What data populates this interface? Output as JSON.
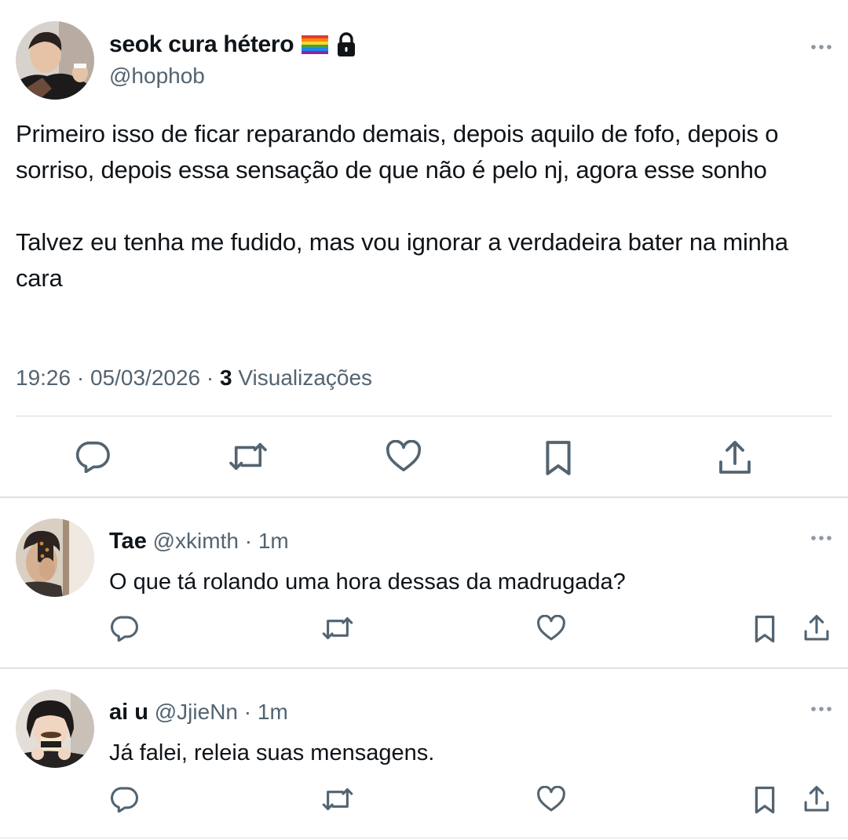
{
  "main_tweet": {
    "display_name": "seok cura hétero",
    "flag_icon": "rainbow-flag",
    "lock_icon": "lock-icon",
    "handle": "@hophob",
    "text": "Primeiro isso de ficar reparando demais, depois aquilo de fofo, depois o sorriso, depois essa sensação de que não é pelo nj, agora esse sonho\n\nTalvez eu tenha me fudido, mas vou ignorar a verdadeira bater na minha cara",
    "time": "19:26",
    "date": "05/03/2026",
    "separator": "·",
    "views_count": "3",
    "views_label": "Visualizações"
  },
  "replies": [
    {
      "name": "Tae",
      "handle": "@xkimth",
      "time": "1m",
      "text": "O que tá rolando uma hora dessas da madrugada?"
    },
    {
      "name": "ai u",
      "handle": "@JjieNn",
      "time": "1m",
      "text": "Já falei, releia suas mensagens."
    }
  ],
  "colors": {
    "text": "#0f1419",
    "secondary": "#536471",
    "divider": "#cfd9de"
  }
}
